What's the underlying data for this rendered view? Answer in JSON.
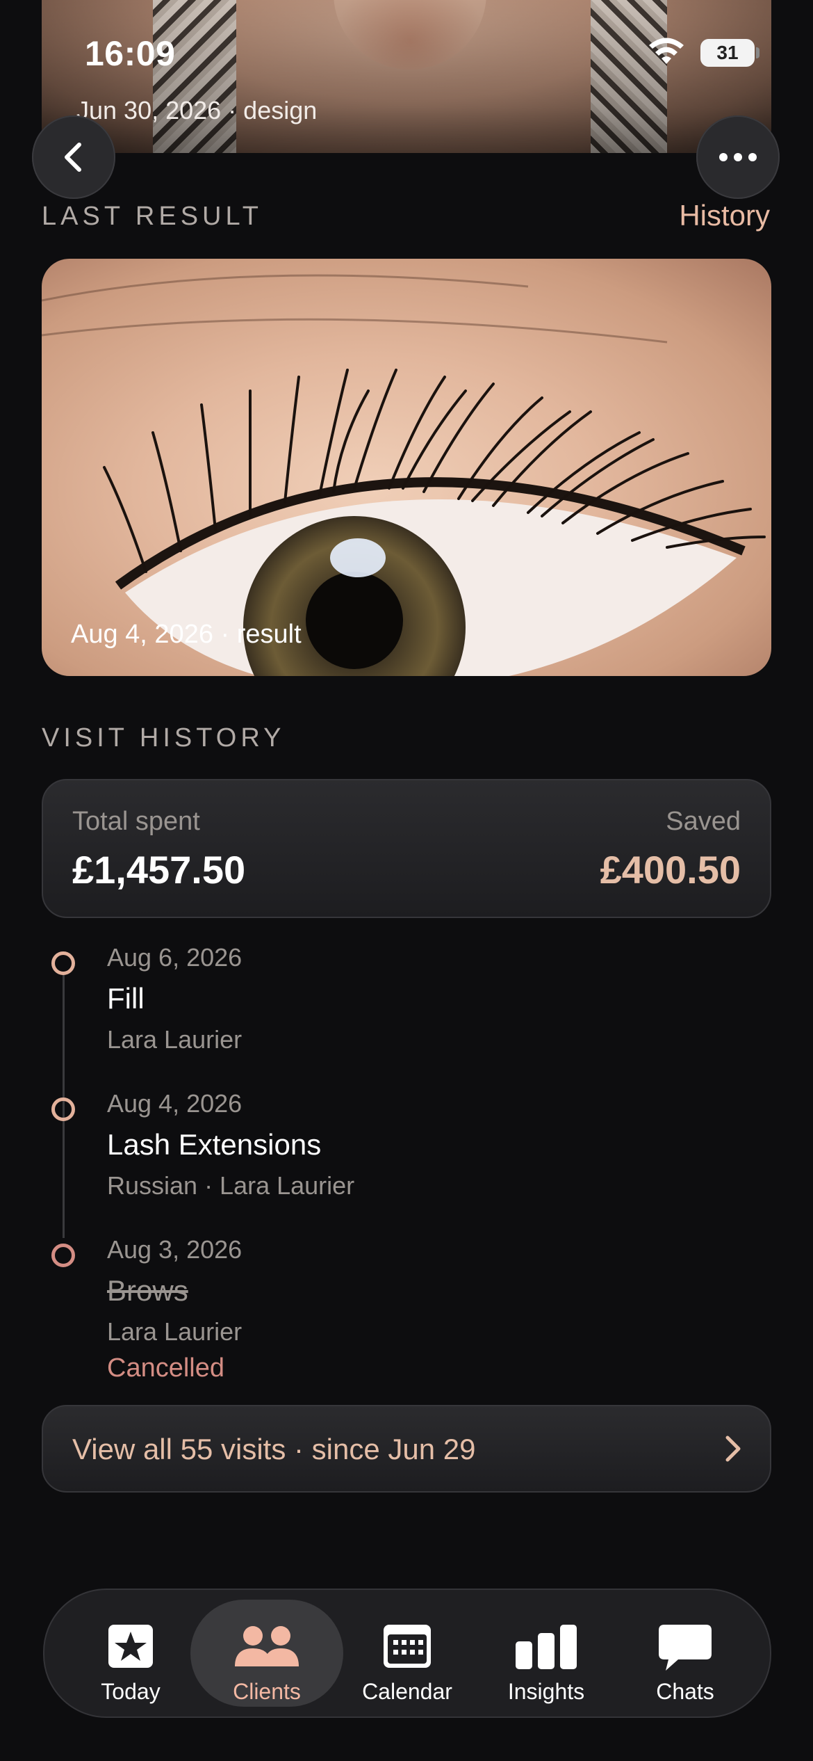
{
  "status_bar": {
    "time": "16:09",
    "battery": "31"
  },
  "header_photo": {
    "caption": "Jun 30, 2026 · design"
  },
  "nav": {
    "back_icon": "chevron-left-icon",
    "more_icon": "ellipsis-icon"
  },
  "last_result": {
    "title": "LAST RESULT",
    "history_link": "History",
    "photo_caption": "Aug 4, 2026 · result"
  },
  "visit_history": {
    "title": "VISIT HISTORY",
    "total_spent_label": "Total spent",
    "total_spent_value": "£1,457.50",
    "saved_label": "Saved",
    "saved_value": "£400.50",
    "visits": [
      {
        "date": "Aug 6, 2026",
        "service": "Fill",
        "detail": "Lara Laurier",
        "status": ""
      },
      {
        "date": "Aug 4, 2026",
        "service": "Lash Extensions",
        "detail": "Russian · Lara Laurier",
        "status": ""
      },
      {
        "date": "Aug 3, 2026",
        "service": "Brows",
        "detail": "Lara Laurier",
        "status": "Cancelled"
      }
    ],
    "view_all": "View all 55 visits · since Jun 29"
  },
  "tabbar": {
    "tabs": [
      {
        "label": "Today",
        "icon": "star-square-icon",
        "active": false
      },
      {
        "label": "Clients",
        "icon": "people-icon",
        "active": true
      },
      {
        "label": "Calendar",
        "icon": "calendar-icon",
        "active": false
      },
      {
        "label": "Insights",
        "icon": "bar-chart-icon",
        "active": false
      },
      {
        "label": "Chats",
        "icon": "chat-bubble-icon",
        "active": false
      }
    ]
  },
  "colors": {
    "accent": "#e5bea7",
    "cancelled": "#d48d84",
    "background": "#0d0d0f"
  }
}
